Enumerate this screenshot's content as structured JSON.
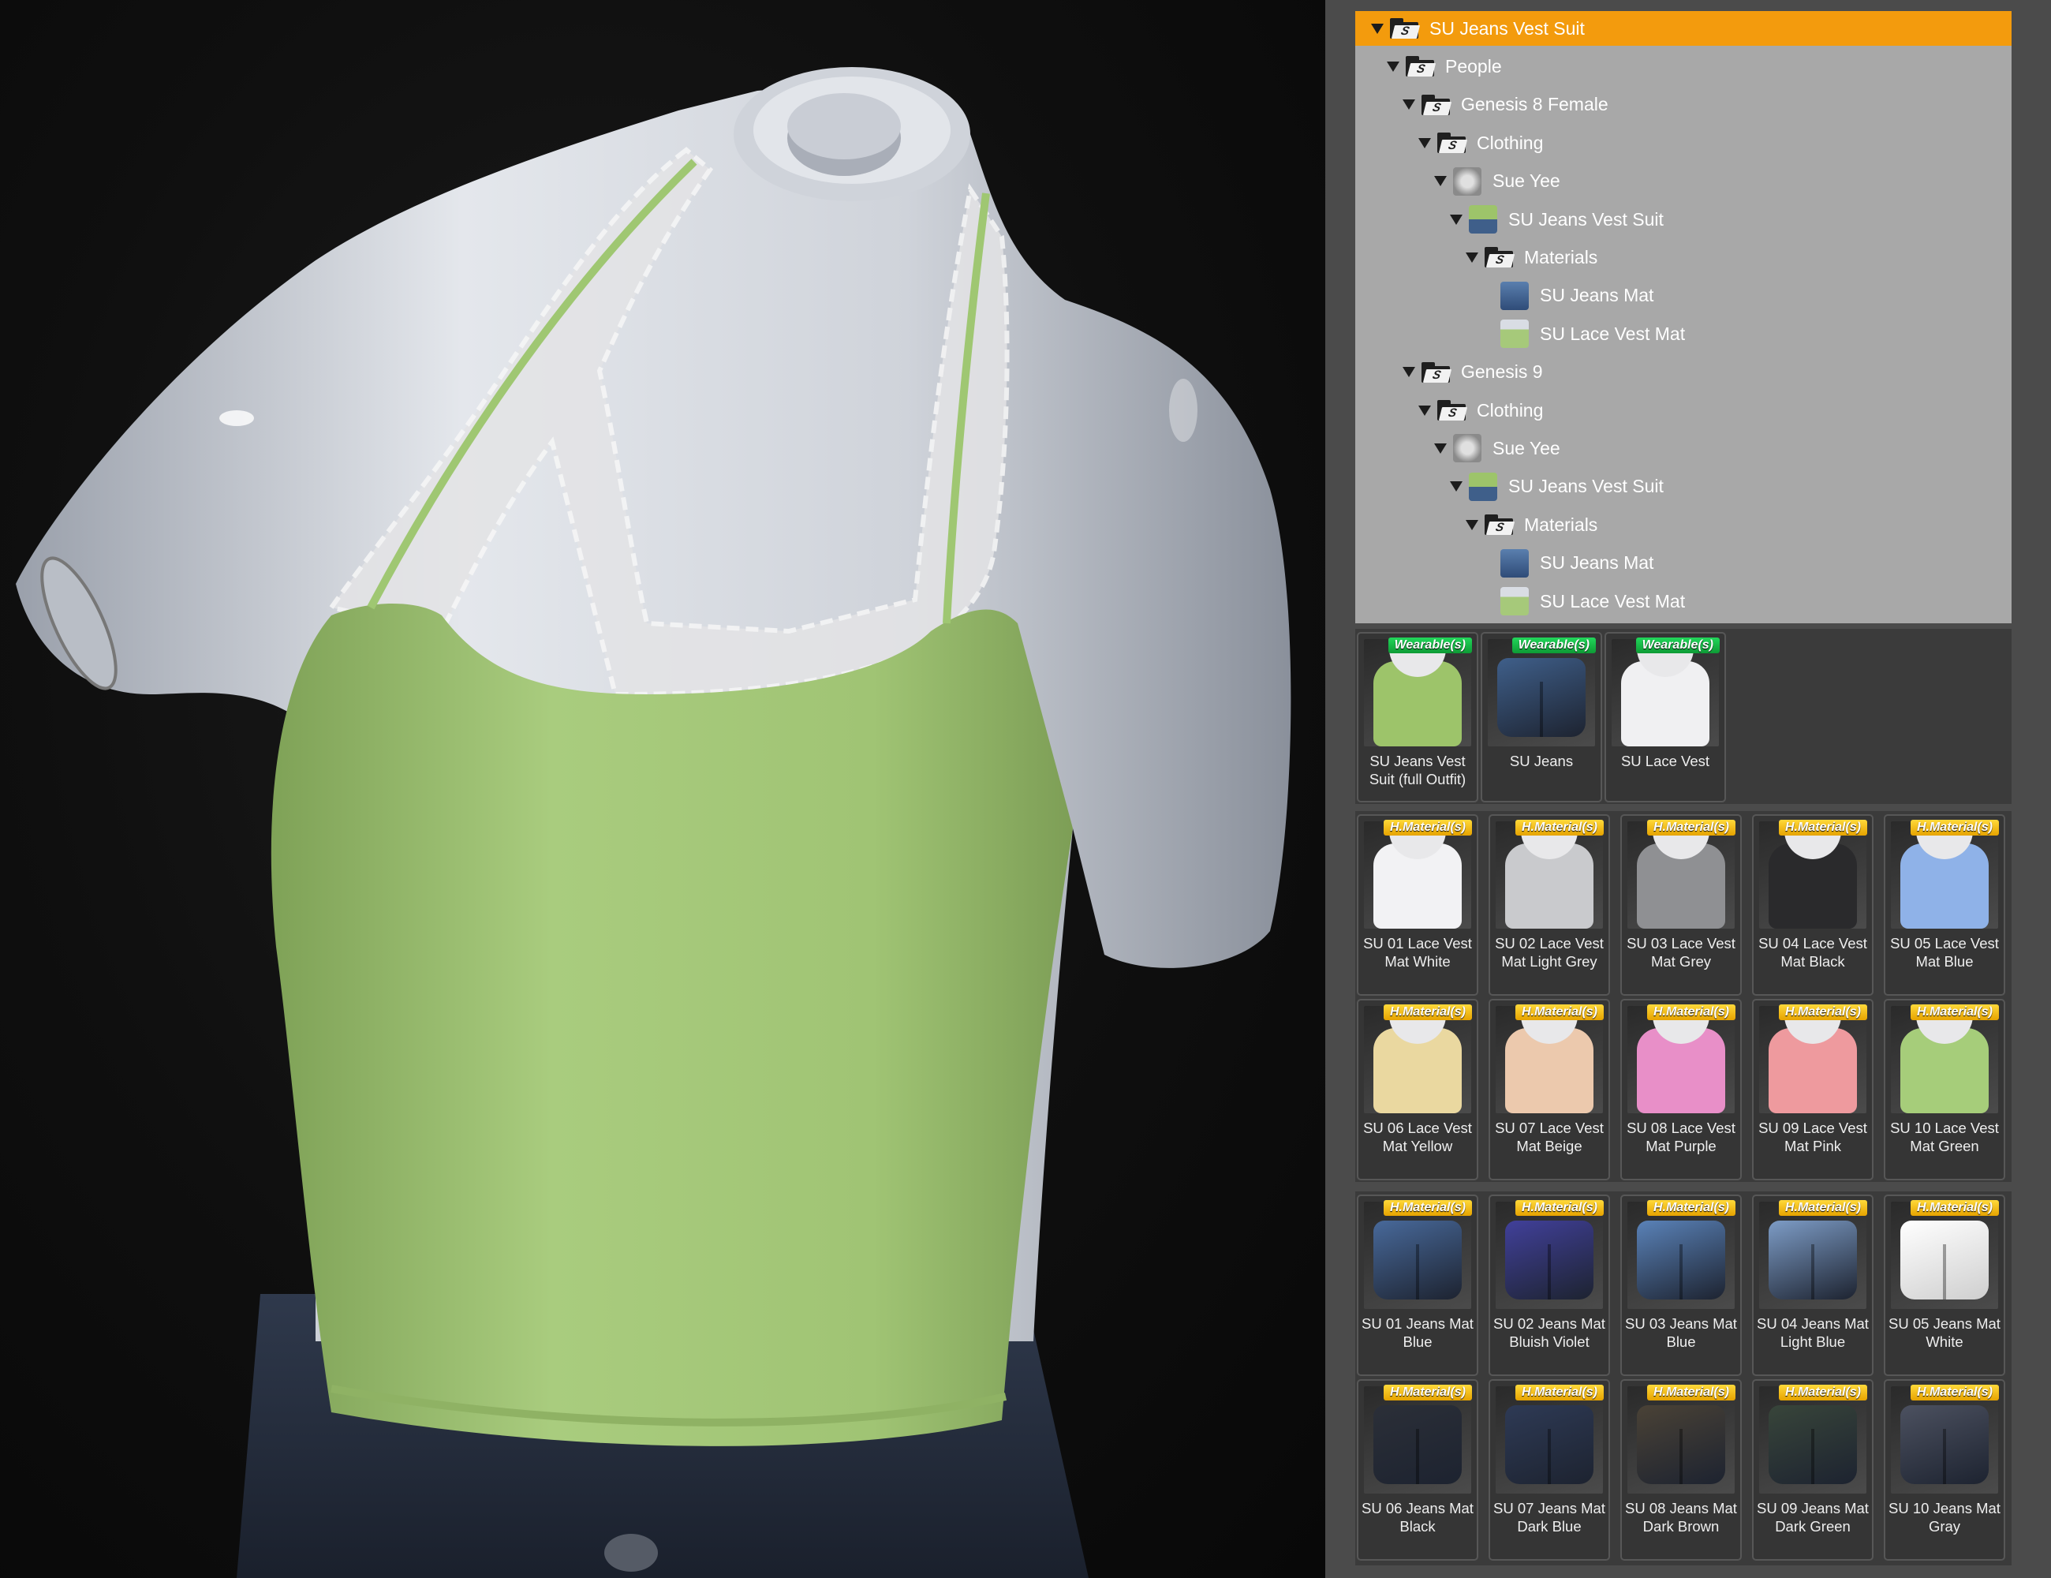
{
  "tree": [
    {
      "label": "SU Jeans Vest Suit",
      "depth": 0,
      "icon": "folder-icon",
      "selected": true,
      "expanded": true
    },
    {
      "label": "People",
      "depth": 1,
      "icon": "folder-icon",
      "expanded": true
    },
    {
      "label": "Genesis 8 Female",
      "depth": 2,
      "icon": "folder-icon",
      "expanded": true
    },
    {
      "label": "Clothing",
      "depth": 3,
      "icon": "folder-icon",
      "expanded": true
    },
    {
      "label": "Sue Yee",
      "depth": 4,
      "icon": "vendor-icon",
      "expanded": true
    },
    {
      "label": "SU Jeans Vest Suit",
      "depth": 5,
      "icon": "product-icon",
      "expanded": true
    },
    {
      "label": "Materials",
      "depth": 6,
      "icon": "folder-icon",
      "expanded": true
    },
    {
      "label": "SU Jeans Mat",
      "depth": 7,
      "icon": "jeans-thumb-icon"
    },
    {
      "label": "SU Lace Vest Mat",
      "depth": 7,
      "icon": "vest-thumb-icon"
    },
    {
      "label": "Genesis 9",
      "depth": 2,
      "icon": "folder-icon",
      "expanded": true
    },
    {
      "label": "Clothing",
      "depth": 3,
      "icon": "folder-icon",
      "expanded": true
    },
    {
      "label": "Sue Yee",
      "depth": 4,
      "icon": "vendor-icon",
      "expanded": true
    },
    {
      "label": "SU Jeans Vest Suit",
      "depth": 5,
      "icon": "product-icon",
      "expanded": true
    },
    {
      "label": "Materials",
      "depth": 6,
      "icon": "folder-icon",
      "expanded": true
    },
    {
      "label": "SU Jeans Mat",
      "depth": 7,
      "icon": "jeans-thumb-icon"
    },
    {
      "label": "SU Lace Vest Mat",
      "depth": 7,
      "icon": "vest-thumb-icon"
    }
  ],
  "wearables": {
    "badge": "Wearable(s)",
    "items": [
      {
        "label": "SU Jeans Vest Suit (full Outfit)",
        "kind": "outfit",
        "color": "#9dc46a"
      },
      {
        "label": "SU Jeans",
        "kind": "jeans",
        "color": "#3f5f8a"
      },
      {
        "label": "SU Lace Vest",
        "kind": "top",
        "color": "#f0f0f2"
      }
    ]
  },
  "vest_materials": {
    "badge": "H.Material(s)",
    "items": [
      {
        "label": "SU 01 Lace Vest Mat White",
        "color": "#f2f2f4"
      },
      {
        "label": "SU 02 Lace Vest Mat Light Grey",
        "color": "#c9cacd"
      },
      {
        "label": "SU 03 Lace Vest Mat Grey",
        "color": "#8f9093"
      },
      {
        "label": "SU 04 Lace Vest Mat Black",
        "color": "#2a2a2c"
      },
      {
        "label": "SU 05 Lace Vest Mat Blue",
        "color": "#8fb2e8"
      },
      {
        "label": "SU 06 Lace Vest Mat Yellow",
        "color": "#ead8a0"
      },
      {
        "label": "SU 07 Lace Vest Mat Beige",
        "color": "#ecc9ad"
      },
      {
        "label": "SU 08 Lace Vest Mat Purple",
        "color": "#e88fc8"
      },
      {
        "label": "SU 09 Lace Vest Mat Pink",
        "color": "#ee9a9e"
      },
      {
        "label": "SU 10 Lace Vest Mat Green",
        "color": "#a6cd7a"
      }
    ]
  },
  "jeans_materials": {
    "badge": "H.Material(s)",
    "items": [
      {
        "label": "SU 01 Jeans Mat Blue",
        "color": "#48699a"
      },
      {
        "label": "SU 02 Jeans Mat Bluish Violet",
        "color": "#41409a"
      },
      {
        "label": "SU 03 Jeans Mat Blue",
        "color": "#5a82b8"
      },
      {
        "label": "SU 04 Jeans Mat Light Blue",
        "color": "#7d9cc6"
      },
      {
        "label": "SU 05 Jeans Mat White",
        "color": "#f4f4f4"
      },
      {
        "label": "SU 06 Jeans Mat Black",
        "color": "#2b2f38"
      },
      {
        "label": "SU 07 Jeans Mat Dark Blue",
        "color": "#2e3a55"
      },
      {
        "label": "SU 08 Jeans Mat Dark Brown",
        "color": "#4a4236"
      },
      {
        "label": "SU 09 Jeans Mat Dark Green",
        "color": "#38453a"
      },
      {
        "label": "SU 10 Jeans Mat Gray",
        "color": "#4c5160"
      }
    ]
  },
  "colors": {
    "selection": "#f39b0d",
    "vest": "#a6c97a",
    "mannequin": "#d9dde4",
    "lace": "#e6e6e6",
    "denim": "#2b3446"
  }
}
